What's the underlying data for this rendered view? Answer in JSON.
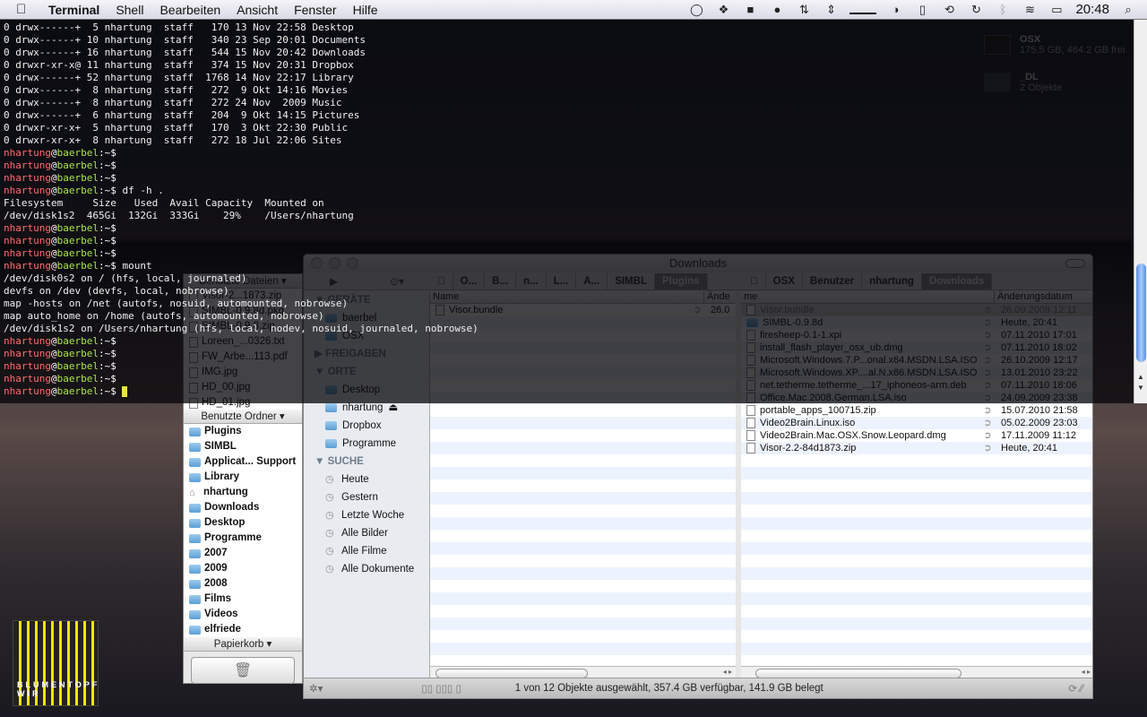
{
  "menubar": {
    "app": "Terminal",
    "items": [
      "Shell",
      "Bearbeiten",
      "Ansicht",
      "Fenster",
      "Hilfe"
    ],
    "clock": "20:48",
    "tray_icons": [
      "growl-icon",
      "dropbox-icon",
      "bag-icon",
      "evernote-icon",
      "network-icon",
      "arrows-icon",
      "memory-icon",
      "cpu-icon",
      "time-machine-icon",
      "sync-icon",
      "bluetooth-icon",
      "wifi-icon",
      "battery-icon",
      "spotlight-icon"
    ]
  },
  "desktop": {
    "items": [
      {
        "name": "OSX",
        "detail": "175.5 GB, 464.2 GB frei"
      },
      {
        "name": "_DL",
        "detail": "2 Objekte"
      }
    ],
    "album": {
      "line1": "BLUMENTOPF",
      "line2": "WIR"
    }
  },
  "terminal": {
    "listing": [
      "0 drwx------+  5 nhartung  staff   170 13 Nov 22:58 Desktop",
      "0 drwx------+ 10 nhartung  staff   340 23 Sep 20:01 Documents",
      "0 drwx------+ 16 nhartung  staff   544 15 Nov 20:42 Downloads",
      "0 drwxr-xr-x@ 11 nhartung  staff   374 15 Nov 20:31 Dropbox",
      "0 drwx------+ 52 nhartung  staff  1768 14 Nov 22:17 Library",
      "0 drwx------+  8 nhartung  staff   272  9 Okt 14:16 Movies",
      "0 drwx------+  8 nhartung  staff   272 24 Nov  2009 Music",
      "0 drwx------+  6 nhartung  staff   204  9 Okt 14:15 Pictures",
      "0 drwxr-xr-x+  5 nhartung  staff   170  3 Okt 22:30 Public",
      "0 drwxr-xr-x+  8 nhartung  staff   272 18 Jul 22:06 Sites"
    ],
    "prompt": {
      "user": "nhartung",
      "host": "baerbel",
      "path": ":~$"
    },
    "block2": [
      {
        "cmd": ""
      },
      {
        "cmd": ""
      },
      {
        "cmd": ""
      },
      {
        "cmd": " df -h ."
      },
      {
        "out": "Filesystem     Size   Used  Avail Capacity  Mounted on"
      },
      {
        "out": "/dev/disk1s2  465Gi  132Gi  333Gi    29%    /Users/nhartung"
      },
      {
        "cmd": ""
      },
      {
        "cmd": ""
      },
      {
        "cmd": ""
      },
      {
        "cmd": " mount"
      },
      {
        "out": "/dev/disk0s2 on / (hfs, local, journaled)"
      },
      {
        "out": "devfs on /dev (devfs, local, nobrowse)"
      },
      {
        "out": "map -hosts on /net (autofs, nosuid, automounted, nobrowse)"
      },
      {
        "out": "map auto_home on /home (autofs, automounted, nobrowse)"
      },
      {
        "out": "/dev/disk1s2 on /Users/nhartung (hfs, local, nodev, nosuid, journaled, nobrowse)"
      },
      {
        "cmd": ""
      },
      {
        "cmd": ""
      },
      {
        "cmd": ""
      },
      {
        "cmd": ""
      },
      {
        "cmd": "",
        "cursor": true
      }
    ]
  },
  "drawer": {
    "recent_files_label": "Benutzte Dateien",
    "recent_files": [
      "Visor-2...1873.zip",
      "SIMBL-0.9.8d.pkg",
      "SIMBL-0.9.8.zip",
      "Loreen_...0326.txt",
      "FW_Arbe...113.pdf",
      "IMG.jpg",
      "HD_00.jpg",
      "HD_01.jpg"
    ],
    "recent_folders_label": "Benutzte Ordner",
    "recent_folders": [
      "Plugins",
      "SIMBL",
      "Applicat... Support",
      "Library",
      "nhartung",
      "Downloads",
      "Desktop",
      "Programme",
      "2007",
      "2009",
      "2008",
      "Films",
      "Videos",
      "elfriede"
    ],
    "trash_label": "Papierkorb"
  },
  "finder": {
    "title": "Downloads",
    "sidebar": {
      "devices_label": "GERÄTE",
      "devices": [
        "baerbel",
        "OSX"
      ],
      "shared_label": "FREIGABEN",
      "places_label": "ORTE",
      "places": [
        "Desktop",
        "nhartung",
        "Dropbox",
        "Programme"
      ],
      "search_label": "SUCHE",
      "searches": [
        "Heute",
        "Gestern",
        "Letzte Woche",
        "Alle Bilder",
        "Alle Filme",
        "Alle Dokumente"
      ]
    },
    "left_pane": {
      "crumbs": [
        "O...",
        "B...",
        "n...",
        "L...",
        "A...",
        "SIMBL",
        "Plugins"
      ],
      "col_name": "Name",
      "col_date": "Ände",
      "rows": [
        {
          "name": "Visor.bundle",
          "date": "26.0"
        }
      ]
    },
    "right_pane": {
      "crumbs": [
        "OSX",
        "Benutzer",
        "nhartung",
        "Downloads"
      ],
      "col_name": "me",
      "col_date": "Änderungsdatum",
      "rows": [
        {
          "name": "Visor.bundle",
          "date": "26.09.2009 12:11",
          "selected": true
        },
        {
          "name": "SIMBL-0.9.8d",
          "date": "Heute, 20:41",
          "folder": true
        },
        {
          "name": "firesheep-0.1-1.xpi",
          "date": "07.11.2010 17:01"
        },
        {
          "name": "install_flash_player_osx_ub.dmg",
          "date": "07.11.2010 18:02"
        },
        {
          "name": "Microsoft.Windows.7.P...onal.x64.MSDN.LSA.ISO",
          "date": "26.10.2009 12:17"
        },
        {
          "name": "Microsoft.Windows.XP....al.N.x86.MSDN.LSA.ISO",
          "date": "13.01.2010 23:22"
        },
        {
          "name": "net.tetherme.tetherme_...17_iphoneos-arm.deb",
          "date": "07.11.2010 18:06"
        },
        {
          "name": "Office.Mac.2008.German.LSA.iso",
          "date": "24.09.2009 23:38"
        },
        {
          "name": "portable_apps_100715.zip",
          "date": "15.07.2010 21:58"
        },
        {
          "name": "Video2Brain.Linux.iso",
          "date": "05.02.2009 23:03"
        },
        {
          "name": "Video2Brain.Mac.OSX.Snow.Leopard.dmg",
          "date": "17.11.2009 11:12"
        },
        {
          "name": "Visor-2.2-84d1873.zip",
          "date": "Heute, 20:41"
        }
      ]
    },
    "status": "1 von 12 Objekte ausgewählt, 357.4 GB verfügbar, 141.9 GB belegt"
  }
}
